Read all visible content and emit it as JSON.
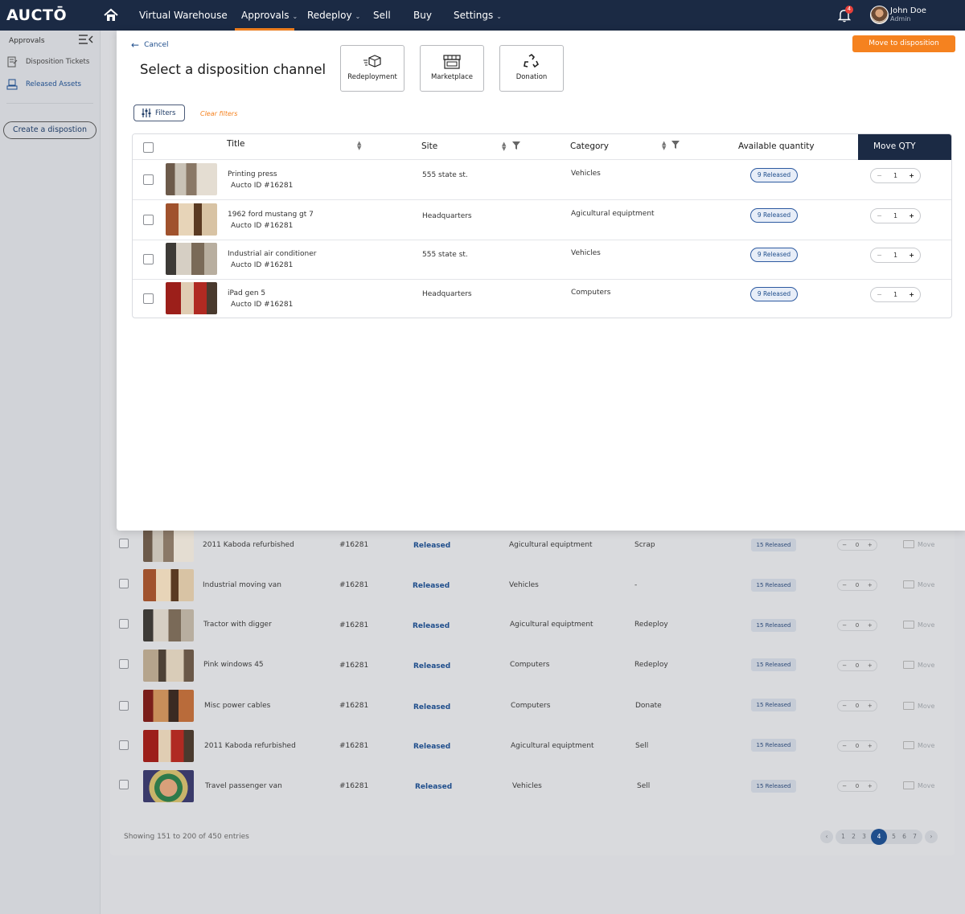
{
  "topnav": {
    "logo": "AUCTŌ",
    "items": [
      {
        "label": "Virtual Warehouse",
        "has_dropdown": false
      },
      {
        "label": "Approvals",
        "has_dropdown": true,
        "active": true
      },
      {
        "label": "Redeploy",
        "has_dropdown": true
      },
      {
        "label": "Sell",
        "has_dropdown": false
      },
      {
        "label": "Buy",
        "has_dropdown": false
      },
      {
        "label": "Settings",
        "has_dropdown": true
      }
    ],
    "notification_count": "4",
    "user": {
      "name": "John Doe",
      "role": "Admin"
    },
    "accent_color": "#f5821f",
    "bg_color": "#1b2a44"
  },
  "sidebar": {
    "title": "Approvals",
    "items": [
      {
        "label": "Disposition Tickets",
        "icon": "ticket-icon"
      },
      {
        "label": "Released Assets",
        "icon": "assets-icon",
        "active": true
      }
    ],
    "create_button": "Create a dispostion"
  },
  "panel": {
    "cancel": "Cancel",
    "title": "Select a disposition channel",
    "channels": [
      {
        "label": "Redeployment",
        "icon": "truck-box-icon"
      },
      {
        "label": "Marketplace",
        "icon": "storefront-icon"
      },
      {
        "label": "Donation",
        "icon": "recycle-icon"
      }
    ],
    "move_button": "Move to disposition",
    "filters_button": "Filters",
    "clear_filters": "Clear filters",
    "columns": {
      "title": "Title",
      "site": "Site",
      "category": "Category",
      "available": "Available quantity",
      "move_qty": "Move QTY"
    },
    "rows": [
      {
        "name": "Printing press",
        "auto_id": "Aucto ID #16281",
        "site": "555 state st.",
        "category": "Vehicles",
        "released": "9 Released",
        "qty": "1"
      },
      {
        "name": "1962 ford mustang gt 7",
        "auto_id": "Aucto ID #16281",
        "site": "Headquarters",
        "category": "Agicultural equiptment",
        "released": "9 Released",
        "qty": "1"
      },
      {
        "name": "Industrial air conditioner",
        "auto_id": "Aucto ID #16281",
        "site": "555 state st.",
        "category": "Vehicles",
        "released": "9 Released",
        "qty": "1"
      },
      {
        "name": "iPad gen 5",
        "auto_id": "Aucto ID #16281",
        "site": "Headquarters",
        "category": "Computers",
        "released": "9 Released",
        "qty": "1"
      }
    ]
  },
  "background_table": {
    "rows": [
      {
        "title": "2011 Kaboda refurbished",
        "id": "#16281",
        "status": "Released",
        "category": "Agicultural equiptment",
        "disposition": "Scrap",
        "released": "15 Released",
        "qty": "0",
        "move": "Move"
      },
      {
        "title": "Industrial moving van",
        "id": "#16281",
        "status": "Released",
        "category": "Vehicles",
        "disposition": "-",
        "released": "15 Released",
        "qty": "0",
        "move": "Move"
      },
      {
        "title": "Tractor with digger",
        "id": "#16281",
        "status": "Released",
        "category": "Agicultural equiptment",
        "disposition": "Redeploy",
        "released": "15 Released",
        "qty": "0",
        "move": "Move"
      },
      {
        "title": "Pink windows 45",
        "id": "#16281",
        "status": "Released",
        "category": "Computers",
        "disposition": "Redeploy",
        "released": "15 Released",
        "qty": "0",
        "move": "Move"
      },
      {
        "title": "Misc power cables",
        "id": "#16281",
        "status": "Released",
        "category": "Computers",
        "disposition": "Donate",
        "released": "15 Released",
        "qty": "0",
        "move": "Move"
      },
      {
        "title": "2011 Kaboda refurbished",
        "id": "#16281",
        "status": "Released",
        "category": "Agicultural equiptment",
        "disposition": "Sell",
        "released": "15 Released",
        "qty": "0",
        "move": "Move"
      },
      {
        "title": "Travel passenger van",
        "id": "#16281",
        "status": "Released",
        "category": "Vehicles",
        "disposition": "Sell",
        "released": "15 Released",
        "qty": "0",
        "move": "Move"
      }
    ],
    "showing": "Showing 151 to 200 of 450 entries",
    "pagination": {
      "pages": [
        "1",
        "2",
        "3",
        "4",
        "5",
        "6",
        "7"
      ],
      "current": "4"
    }
  }
}
